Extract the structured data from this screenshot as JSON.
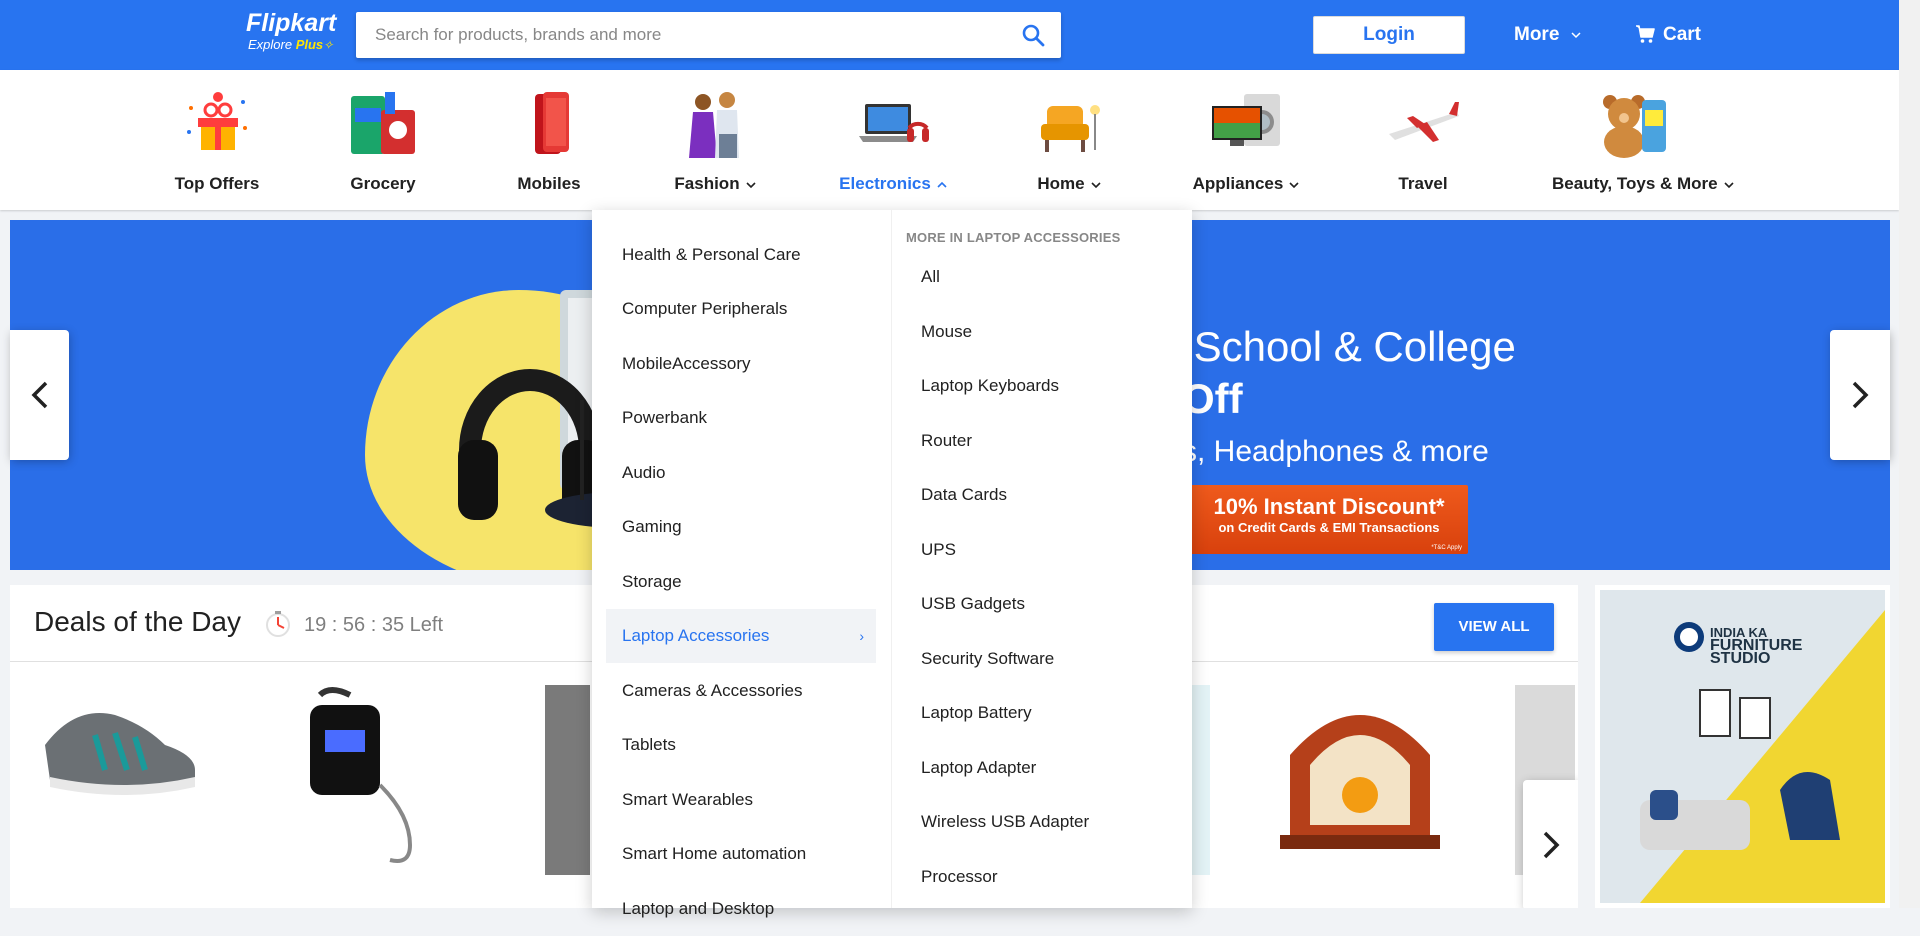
{
  "header": {
    "logo_text": "Flipkart",
    "logo_sub_prefix": "Explore",
    "logo_sub_plus": "Plus",
    "search_placeholder": "Search for products, brands and more",
    "login_label": "Login",
    "more_label": "More",
    "cart_label": "Cart",
    "brand_color": "#2874f0"
  },
  "categories": [
    {
      "label": "Top Offers",
      "icon": "gift-icon",
      "has_chevron": false
    },
    {
      "label": "Grocery",
      "icon": "grocery-icon",
      "has_chevron": false
    },
    {
      "label": "Mobiles",
      "icon": "mobile-phone-icon",
      "has_chevron": false
    },
    {
      "label": "Fashion",
      "icon": "fashion-people-icon",
      "has_chevron": true
    },
    {
      "label": "Electronics",
      "icon": "laptop-headphones-icon",
      "has_chevron": true,
      "active": true
    },
    {
      "label": "Home",
      "icon": "armchair-icon",
      "has_chevron": true
    },
    {
      "label": "Appliances",
      "icon": "tv-washer-icon",
      "has_chevron": true
    },
    {
      "label": "Travel",
      "icon": "airplane-icon",
      "has_chevron": false
    },
    {
      "label": "Beauty, Toys & More",
      "icon": "teddy-bear-icon",
      "has_chevron": true
    }
  ],
  "banner": {
    "line1": "r School & College",
    "line2": "Off",
    "line3": "s, Headphones & more",
    "discount_main": "10% Instant Discount*",
    "discount_sub": "on Credit Cards & EMI Transactions",
    "discount_tc": "*T&C Apply"
  },
  "deals": {
    "title": "Deals of the Day",
    "timer": "19 : 56 : 35 Left",
    "view_all": "VIEW ALL"
  },
  "side_ad": {
    "line1": "INDIA KA",
    "line2": "FURNITURE",
    "line3": "STUDIO"
  },
  "dropdown": {
    "left_items": [
      "Health & Personal Care",
      "Computer Peripherals",
      "MobileAccessory",
      "Powerbank",
      "Audio",
      "Gaming",
      "Storage",
      "Laptop Accessories",
      "Cameras & Accessories",
      "Tablets",
      "Smart Wearables",
      "Smart Home automation",
      "Laptop and Desktop"
    ],
    "active_index": 7,
    "right_heading": "MORE IN LAPTOP ACCESSORIES",
    "right_items": [
      "All",
      "Mouse",
      "Laptop Keyboards",
      "Router",
      "Data Cards",
      "UPS",
      "USB Gadgets",
      "Security Software",
      "Laptop Battery",
      "Laptop Adapter",
      "Wireless USB Adapter",
      "Processor"
    ]
  }
}
